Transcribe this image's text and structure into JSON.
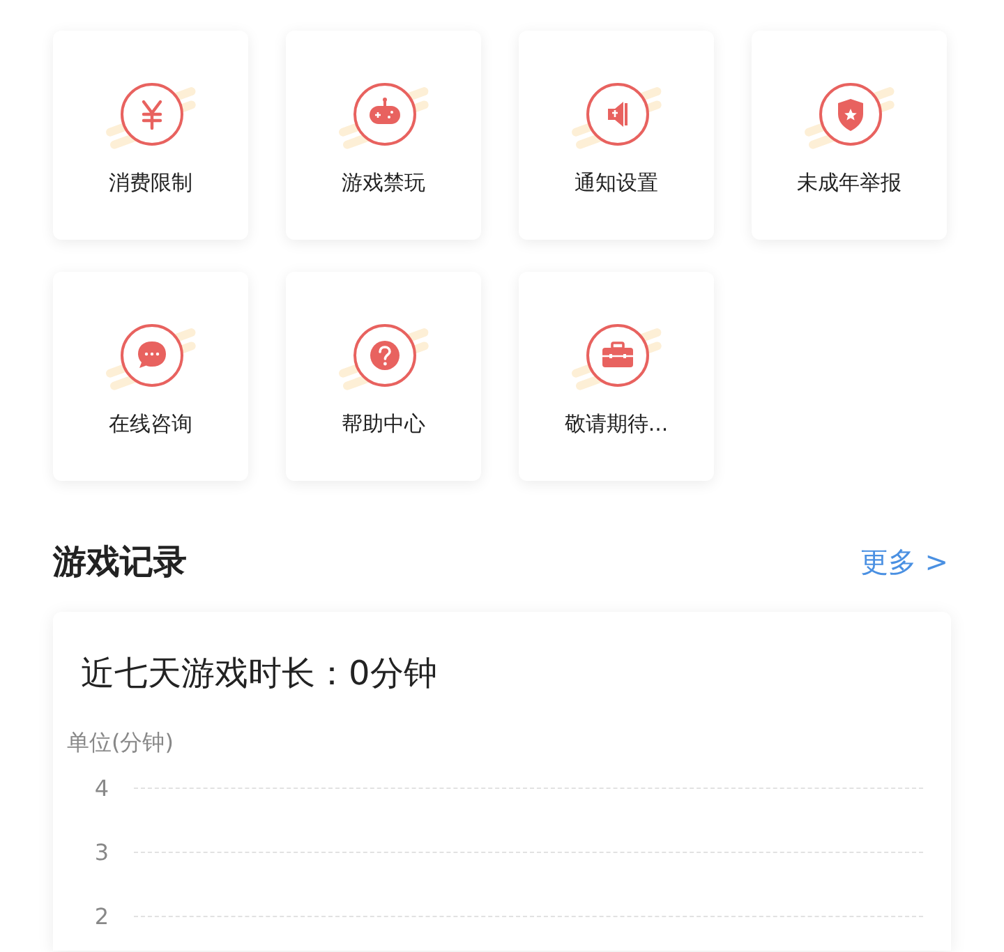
{
  "tools": [
    {
      "label": "消费限制",
      "kind": "yuan"
    },
    {
      "label": "游戏禁玩",
      "kind": "gamepad"
    },
    {
      "label": "通知设置",
      "kind": "speaker"
    },
    {
      "label": "未成年举报",
      "kind": "shield"
    },
    {
      "label": "在线咨询",
      "kind": "chat"
    },
    {
      "label": "帮助中心",
      "kind": "help"
    },
    {
      "label": "敬请期待...",
      "kind": "toolbox"
    }
  ],
  "records": {
    "title": "游戏记录",
    "more": "更多 >",
    "summary": "近七天游戏时长：0分钟",
    "unit_label": "单位(分钟)",
    "axis_labels": [
      "4",
      "3",
      "2"
    ]
  }
}
